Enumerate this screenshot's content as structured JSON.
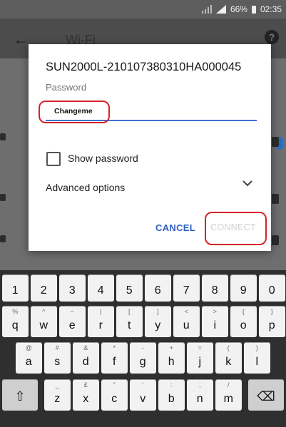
{
  "statusbar": {
    "battery": "66%",
    "time": "02:35"
  },
  "appbar": {
    "title": "Wi-Fi"
  },
  "dialog": {
    "network_name": "SUN2000L-210107380310HA000045",
    "password_label": "Password",
    "password_value": "Changeme",
    "show_password_label": "Show password",
    "show_password_checked": false,
    "advanced_label": "Advanced options",
    "cancel_label": "CANCEL",
    "connect_label": "CONNECT"
  },
  "keyboard": {
    "row1": [
      {
        "main": "1"
      },
      {
        "main": "2"
      },
      {
        "main": "3"
      },
      {
        "main": "4"
      },
      {
        "main": "5"
      },
      {
        "main": "6"
      },
      {
        "main": "7"
      },
      {
        "main": "8"
      },
      {
        "main": "9"
      },
      {
        "main": "0"
      }
    ],
    "row2": [
      {
        "main": "q",
        "sub": "%"
      },
      {
        "main": "w",
        "sub": "^"
      },
      {
        "main": "e",
        "sub": "~"
      },
      {
        "main": "r",
        "sub": "|"
      },
      {
        "main": "t",
        "sub": "["
      },
      {
        "main": "y",
        "sub": "]"
      },
      {
        "main": "u",
        "sub": "<"
      },
      {
        "main": "i",
        "sub": ">"
      },
      {
        "main": "o",
        "sub": "{"
      },
      {
        "main": "p",
        "sub": "}"
      }
    ],
    "row3": [
      {
        "main": "a",
        "sub": "@"
      },
      {
        "main": "s",
        "sub": "#"
      },
      {
        "main": "d",
        "sub": "&"
      },
      {
        "main": "f",
        "sub": "*"
      },
      {
        "main": "g",
        "sub": "-"
      },
      {
        "main": "h",
        "sub": "+"
      },
      {
        "main": "j",
        "sub": "="
      },
      {
        "main": "k",
        "sub": "("
      },
      {
        "main": "l",
        "sub": ")"
      }
    ],
    "row4": [
      {
        "main": "z",
        "sub": "_"
      },
      {
        "main": "x",
        "sub": "£"
      },
      {
        "main": "c",
        "sub": "\""
      },
      {
        "main": "v",
        "sub": "'"
      },
      {
        "main": "b",
        "sub": ":"
      },
      {
        "main": "n",
        "sub": ";"
      },
      {
        "main": "m",
        "sub": "/"
      }
    ]
  },
  "colors": {
    "accent": "#3f6fcf",
    "highlight_circle": "#d6232a"
  },
  "icons": {
    "back": "arrow-back-icon",
    "help": "help-icon",
    "chevron": "chevron-down-icon",
    "shift": "shift-icon",
    "backspace": "backspace-icon"
  }
}
